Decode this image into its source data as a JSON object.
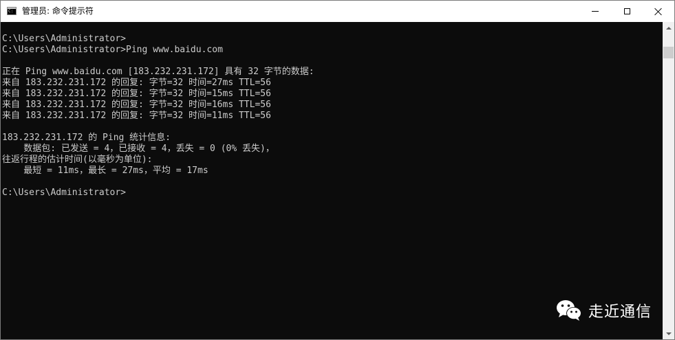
{
  "window": {
    "title": "管理员: 命令提示符"
  },
  "console": {
    "lines": [
      "C:\\Users\\Administrator>",
      "C:\\Users\\Administrator>Ping www.baidu.com",
      "",
      "正在 Ping www.baidu.com [183.232.231.172] 具有 32 字节的数据:",
      "来自 183.232.231.172 的回复: 字节=32 时间=27ms TTL=56",
      "来自 183.232.231.172 的回复: 字节=32 时间=15ms TTL=56",
      "来自 183.232.231.172 的回复: 字节=32 时间=16ms TTL=56",
      "来自 183.232.231.172 的回复: 字节=32 时间=11ms TTL=56",
      "",
      "183.232.231.172 的 Ping 统计信息:",
      "    数据包: 已发送 = 4，已接收 = 4，丢失 = 0 (0% 丢失)，",
      "往返行程的估计时间(以毫秒为单位):",
      "    最短 = 11ms，最长 = 27ms，平均 = 17ms",
      "",
      "C:\\Users\\Administrator>"
    ]
  },
  "watermark": {
    "text": "走近通信"
  },
  "icons": {
    "app": "cmd-icon",
    "wechat": "wechat-icon"
  },
  "colors": {
    "console_bg": "#0c0c0c",
    "console_fg": "#cccccc",
    "titlebar_bg": "#ffffff"
  }
}
